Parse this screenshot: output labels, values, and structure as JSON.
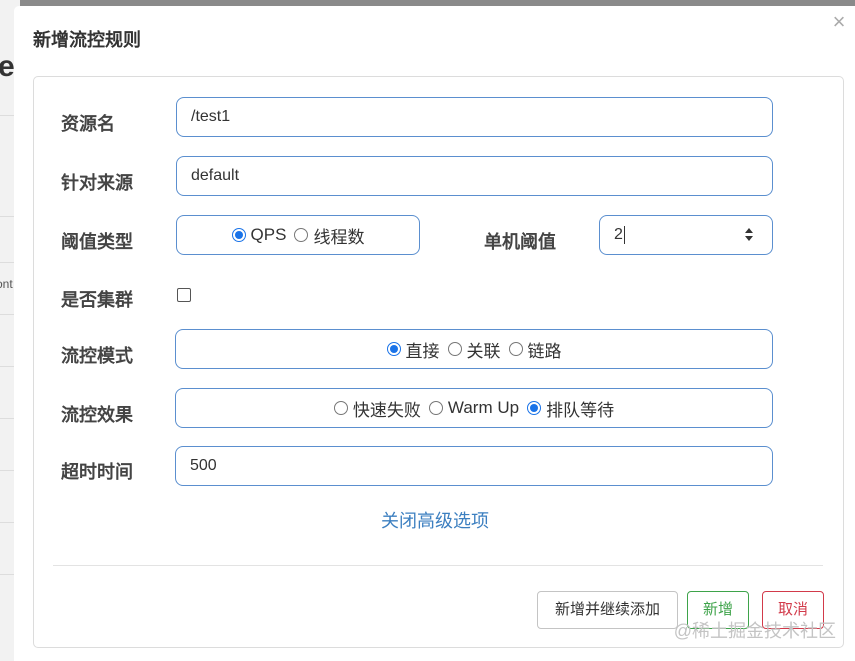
{
  "background": {
    "heading_fragment": "e",
    "text_fragment": "ont"
  },
  "dialog": {
    "title": "新增流控规则",
    "close_label": "×"
  },
  "form": {
    "resource": {
      "label": "资源名",
      "value": "/test1"
    },
    "limit_app": {
      "label": "针对来源",
      "value": "default"
    },
    "threshold_type": {
      "label": "阈值类型",
      "options": [
        {
          "label": "QPS",
          "checked": true
        },
        {
          "label": "线程数",
          "checked": false
        }
      ]
    },
    "single_threshold": {
      "label": "单机阈值",
      "value": "2"
    },
    "cluster": {
      "label": "是否集群",
      "checked": false
    },
    "control_mode": {
      "label": "流控模式",
      "options": [
        {
          "label": "直接",
          "checked": true
        },
        {
          "label": "关联",
          "checked": false
        },
        {
          "label": "链路",
          "checked": false
        }
      ]
    },
    "control_effect": {
      "label": "流控效果",
      "options": [
        {
          "label": "快速失败",
          "checked": false
        },
        {
          "label": "Warm Up",
          "checked": false
        },
        {
          "label": "排队等待",
          "checked": true
        }
      ]
    },
    "timeout": {
      "label": "超时时间",
      "value": "500"
    },
    "advanced_toggle": "关闭高级选项"
  },
  "footer": {
    "add_continue": "新增并继续添加",
    "add": "新增",
    "cancel": "取消"
  },
  "watermark": "@稀土掘金技术社区",
  "colors": {
    "accent": "#1a73e8",
    "border": "#5b8fcf",
    "link": "#3c7fc0",
    "success": "#3ea34a",
    "danger": "#d23a4a"
  }
}
